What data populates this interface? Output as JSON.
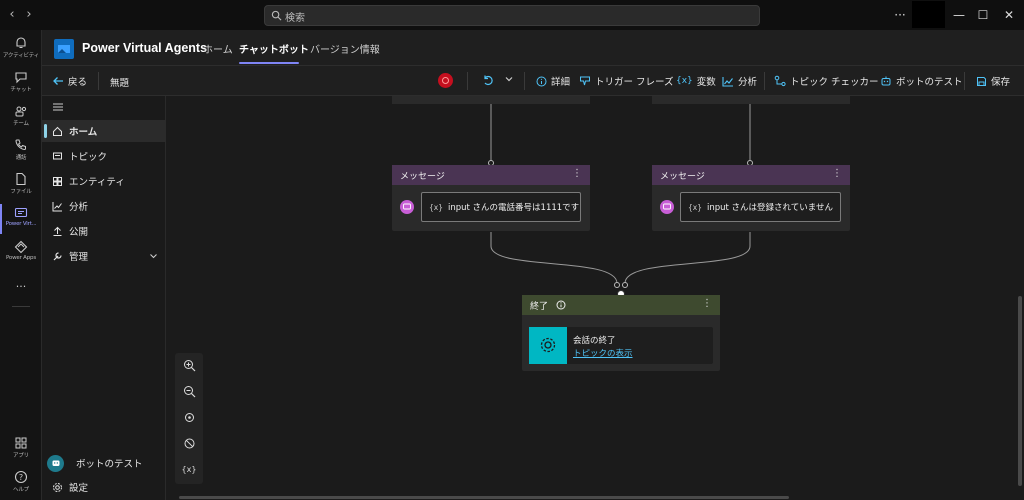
{
  "titlebar": {
    "back": "‹",
    "forward": "›",
    "search_placeholder": "検索",
    "more": "···",
    "minimize": "—",
    "maximize": "☐",
    "close": "✕"
  },
  "rail": {
    "items": [
      {
        "label": "アクティビティ",
        "icon": "bell-icon"
      },
      {
        "label": "チャット",
        "icon": "chat-icon"
      },
      {
        "label": "チーム",
        "icon": "teams-icon"
      },
      {
        "label": "通話",
        "icon": "phone-icon"
      },
      {
        "label": "ファイル",
        "icon": "file-icon"
      },
      {
        "label": "Power Virt...",
        "icon": "power-virtual-agents-icon"
      },
      {
        "label": "Power Apps",
        "icon": "power-apps-icon"
      }
    ],
    "more": "···",
    "bottom": [
      {
        "label": "アプリ",
        "icon": "apps-icon"
      },
      {
        "label": "ヘルプ",
        "icon": "help-icon"
      }
    ]
  },
  "app": {
    "name": "Power Virtual Agents",
    "tabs": [
      {
        "label": "ホーム"
      },
      {
        "label": "チャットボット"
      },
      {
        "label": "バージョン情報"
      }
    ]
  },
  "toolbar": {
    "back": "戻る",
    "topic_name": "無題",
    "details": "詳細",
    "trigger_phrases": "トリガー フレーズ",
    "variables": "変数",
    "analytics": "分析",
    "topic_checker": "トピック チェッカー",
    "test_bot": "ボットのテスト",
    "save": "保存"
  },
  "nav": {
    "items": [
      {
        "label": "ホーム"
      },
      {
        "label": "トピック"
      },
      {
        "label": "エンティティ"
      },
      {
        "label": "分析"
      },
      {
        "label": "公開"
      },
      {
        "label": "管理"
      }
    ],
    "test_bot": "ボットのテスト",
    "settings": "設定"
  },
  "canvas": {
    "message_node_1": {
      "title": "メッセージ",
      "var_chip": "{x}",
      "text": "input さんの電話番号は1111です"
    },
    "message_node_2": {
      "title": "メッセージ",
      "var_chip": "{x}",
      "text": "input さんは登録されていません"
    },
    "end_node": {
      "title": "終了",
      "action_title": "会話の終了",
      "action_link": "トピックの表示"
    },
    "zoom": {
      "var_label": "{x}"
    }
  },
  "colors": {
    "accent": "#7f85f5",
    "message_header": "#4a3453",
    "end_header": "#3e4a2f",
    "end_action": "#00b7c3",
    "error": "#c50f1f",
    "link": "#4fc3f7"
  }
}
